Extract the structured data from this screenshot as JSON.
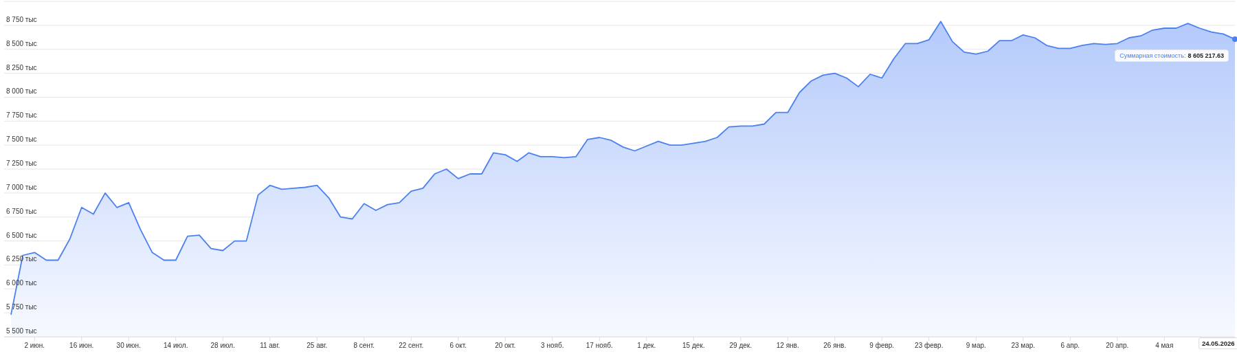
{
  "chart": {
    "chart_data": {
      "type": "area",
      "categories": [
        null,
        null,
        "2 июн.",
        null,
        null,
        null,
        "16 июн.",
        null,
        null,
        null,
        "30 июн.",
        null,
        null,
        null,
        "14 июл.",
        null,
        null,
        null,
        "28 июл.",
        null,
        null,
        null,
        "11 авг.",
        null,
        null,
        null,
        "25 авг.",
        null,
        null,
        null,
        "8 сент.",
        null,
        null,
        null,
        "22 сент.",
        null,
        null,
        null,
        "6 окт.",
        null,
        null,
        null,
        "20 окт.",
        null,
        null,
        null,
        "3 нояб.",
        null,
        null,
        null,
        "17 нояб.",
        null,
        null,
        null,
        "1 дек.",
        null,
        null,
        null,
        "15 дек.",
        null,
        null,
        null,
        "29 дек.",
        null,
        null,
        null,
        "12 янв.",
        null,
        null,
        null,
        "26 янв.",
        null,
        null,
        null,
        "9 февр.",
        null,
        null,
        null,
        "23 февр.",
        null,
        null,
        null,
        "9 мар.",
        null,
        null,
        null,
        "23 мар.",
        null,
        null,
        null,
        "6 апр.",
        null,
        null,
        null,
        "20 апр.",
        null,
        null,
        null,
        "4 мая",
        null,
        null,
        null,
        null,
        null,
        null
      ],
      "series": [
        {
          "color": "#4a80f0",
          "values": [
            5730,
            6350,
            6380,
            6300,
            6300,
            6520,
            6850,
            6780,
            7000,
            6850,
            6900,
            6620,
            6380,
            6300,
            6300,
            6550,
            6560,
            6420,
            6400,
            6500,
            6500,
            6980,
            7080,
            7040,
            7050,
            7060,
            7080,
            6950,
            6750,
            6730,
            6890,
            6820,
            6880,
            6900,
            7020,
            7050,
            7200,
            7250,
            7150,
            7200,
            7200,
            7420,
            7400,
            7330,
            7420,
            7380,
            7380,
            7370,
            7380,
            7560,
            7580,
            7550,
            7480,
            7440,
            7490,
            7540,
            7500,
            7500,
            7520,
            7540,
            7580,
            7690,
            7700,
            7700,
            7720,
            7840,
            7840,
            8050,
            8170,
            8230,
            8250,
            8200,
            8110,
            8240,
            8200,
            8400,
            8560,
            8560,
            8600,
            8790,
            8580,
            8470,
            8450,
            8480,
            8590,
            8590,
            8650,
            8620,
            8540,
            8510,
            8510,
            8540,
            8560,
            8550,
            8560,
            8620,
            8640,
            8700,
            8720,
            8720,
            8770,
            8720,
            8680,
            8660,
            8605
          ]
        }
      ],
      "ylim": [
        5500,
        9000
      ],
      "grid": true,
      "yticks": [
        {
          "value": 5500,
          "label": "5 500 тыс"
        },
        {
          "value": 5750,
          "label": "5 750 тыс"
        },
        {
          "value": 6000,
          "label": "6 000 тыс"
        },
        {
          "value": 6250,
          "label": "6 250 тыс"
        },
        {
          "value": 6500,
          "label": "6 500 тыс"
        },
        {
          "value": 6750,
          "label": "6 750 тыс"
        },
        {
          "value": 7000,
          "label": "7 000 тыс"
        },
        {
          "value": 7250,
          "label": "7 250 тыс"
        },
        {
          "value": 7500,
          "label": "7 500 тыс"
        },
        {
          "value": 7750,
          "label": "7 750 тыс"
        },
        {
          "value": 8000,
          "label": "8 000 тыс"
        },
        {
          "value": 8250,
          "label": "8 250 тыс"
        },
        {
          "value": 8500,
          "label": "8 500 тыс"
        },
        {
          "value": 8750,
          "label": "8 750 тыс"
        }
      ]
    },
    "tooltip": {
      "label": "Суммарная стоимость:",
      "value": "8 605 217.63"
    },
    "crosshair_date": "24.05.2026"
  }
}
